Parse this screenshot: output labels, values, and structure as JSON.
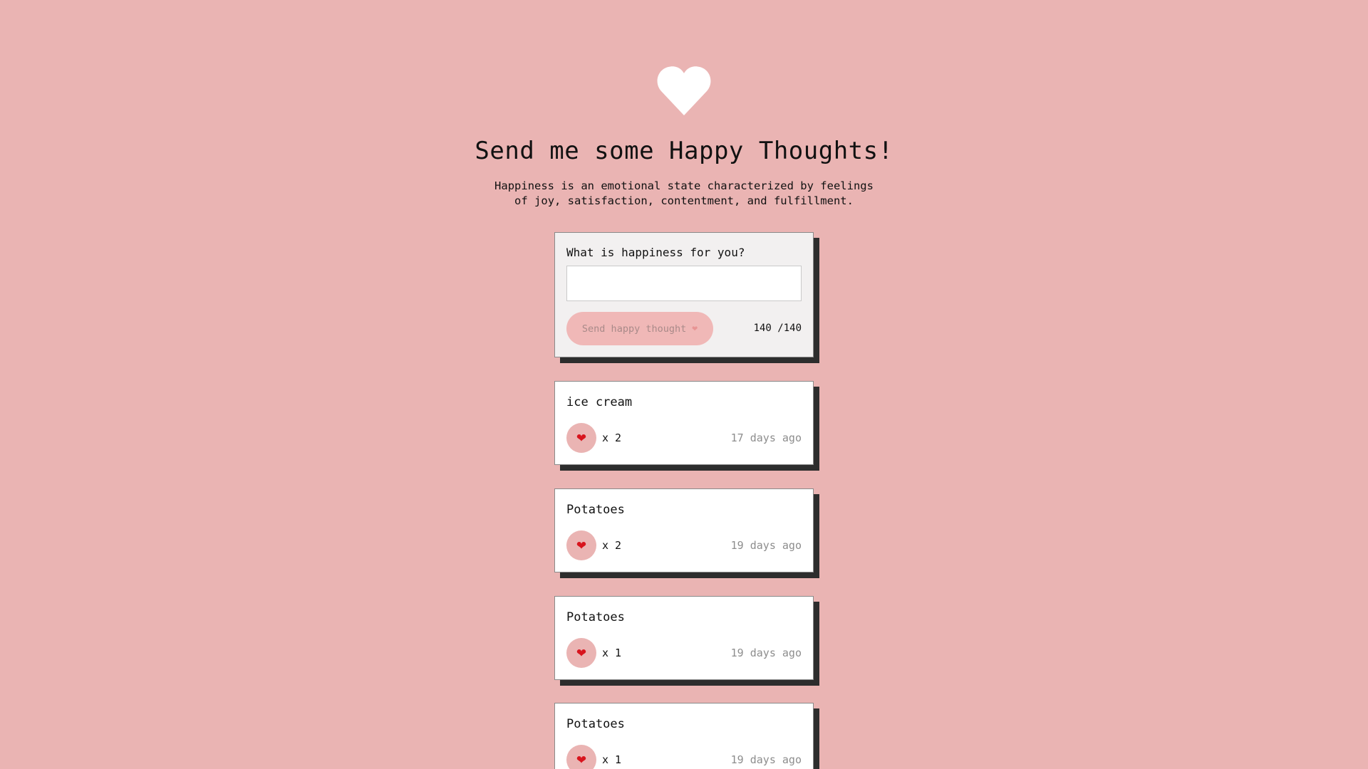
{
  "header": {
    "icon": "heart-icon",
    "title": "Send me some Happy Thoughts!",
    "subtitle_line1": "Happiness is an emotional state characterized by feelings",
    "subtitle_line2": "of joy, satisfaction, contentment, and fulfillment."
  },
  "form": {
    "label": "What is happiness for you?",
    "input_value": "",
    "button_label": "Send happy thought",
    "button_icon": "❤",
    "counter": "140 /140"
  },
  "thoughts": [
    {
      "text": "ice cream",
      "heart": "❤",
      "likes": "x 2",
      "time": "17 days ago"
    },
    {
      "text": "Potatoes",
      "heart": "❤",
      "likes": "x 2",
      "time": "19 days ago"
    },
    {
      "text": "Potatoes",
      "heart": "❤",
      "likes": "x 1",
      "time": "19 days ago"
    },
    {
      "text": "Potatoes",
      "heart": "❤",
      "likes": "x 1",
      "time": "19 days ago"
    }
  ],
  "colors": {
    "background": "#eab4b3",
    "card_shadow": "#2d2d2d",
    "button": "#f0b8b7",
    "heart_red": "#d8141d"
  }
}
